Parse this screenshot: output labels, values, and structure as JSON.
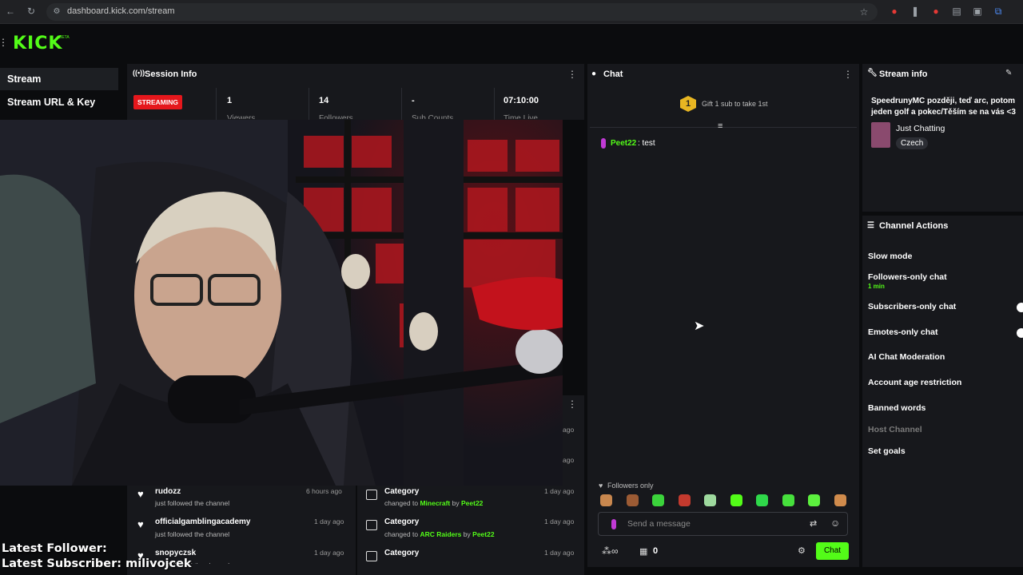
{
  "browser": {
    "url": "dashboard.kick.com/stream"
  },
  "app": {
    "logo": "KICK",
    "logo_badge": "BETA"
  },
  "sidebar": {
    "items": [
      {
        "label": "Stream"
      },
      {
        "label": "Stream URL & Key"
      }
    ]
  },
  "session": {
    "title": "Session Info",
    "status_badge": "STREAMING",
    "stats": [
      {
        "value": "1",
        "label": "Viewers"
      },
      {
        "value": "14",
        "label": "Followers"
      },
      {
        "value": "-",
        "label": "Sub Counts"
      },
      {
        "value": "07:10:00",
        "label": "Time Live"
      }
    ]
  },
  "activity": {
    "followers": [
      {
        "name": "rudozz",
        "action": "just followed the channel",
        "time": "6 hours ago"
      },
      {
        "name": "officialgamblingacademy",
        "action": "just followed the channel",
        "time": "1 day ago"
      },
      {
        "name": "snopyczsk",
        "action": "just followed the channel",
        "time": "1 day ago"
      }
    ],
    "hidden_times": [
      "ago",
      "ago"
    ],
    "events": [
      {
        "title": "Category",
        "prefix": "changed to",
        "value": "Minecraft",
        "by": "by",
        "user": "Peet22",
        "time": "1 day ago"
      },
      {
        "title": "Category",
        "prefix": "changed to",
        "value": "ARC Raiders",
        "by": "by",
        "user": "Peet22",
        "time": "1 day ago"
      },
      {
        "title": "Category",
        "prefix": "",
        "value": "",
        "by": "",
        "user": "",
        "time": "1 day ago"
      }
    ]
  },
  "chat": {
    "title": "Chat",
    "gift_rank": "1",
    "gift_text": "Gift 1 sub to take 1st",
    "messages": [
      {
        "user": "Peet22",
        "text": ": test",
        "user_color": "#53fc18"
      }
    ],
    "mode_label": "Followers only",
    "placeholder": "Send a message",
    "viewer_count": "0",
    "send_label": "Chat"
  },
  "stream_info": {
    "title": "Stream info",
    "stream_title": "SpeedrunyMC později, teď arc, potom jeden golf a pokec/Těším se na vás <3",
    "category": "Just Chatting",
    "language": "Czech"
  },
  "channel_actions": {
    "title": "Channel Actions",
    "items": [
      {
        "label": "Slow mode"
      },
      {
        "label": "Followers-only chat",
        "sub": "1 min"
      },
      {
        "label": "Subscribers-only chat"
      },
      {
        "label": "Emotes-only chat"
      },
      {
        "label": "AI Chat Moderation"
      },
      {
        "label": "Account age restriction"
      },
      {
        "label": "Banned words"
      },
      {
        "label": "Host Channel"
      },
      {
        "label": "Set goals"
      }
    ]
  },
  "overlay": {
    "latest_follower": "Latest Follower:",
    "latest_subscriber": "Latest Subscriber: milivojcek"
  },
  "colors": {
    "accent": "#53fc18",
    "live": "#e5171c",
    "panel": "#17181c"
  }
}
